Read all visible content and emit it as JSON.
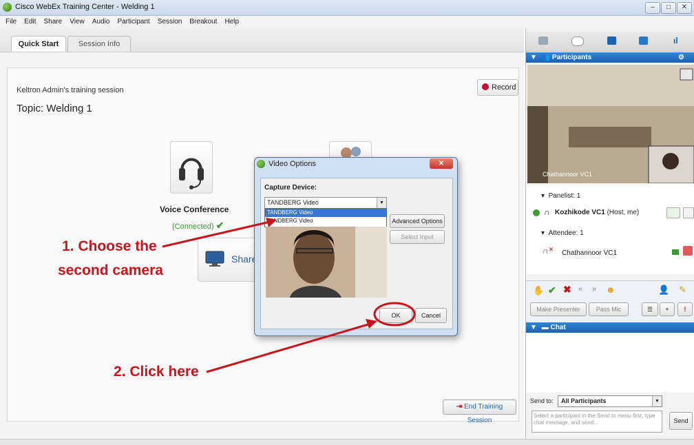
{
  "window": {
    "title": "Cisco WebEx Training Center - Welding 1"
  },
  "menu": [
    "File",
    "Edit",
    "Share",
    "View",
    "Audio",
    "Participant",
    "Session",
    "Breakout",
    "Help"
  ],
  "tabs": {
    "quick_start": "Quick Start",
    "session_info": "Session Info"
  },
  "session": {
    "host_line": "Keltron Admin's training session",
    "topic_label": "Topic:",
    "topic_value": "Welding 1",
    "record_label": "Record",
    "voice_label": "Voice Conference",
    "voice_status": "(Connected)",
    "share_label": "Share",
    "end_session_label": "End Training Session"
  },
  "dialog": {
    "title": "Video Options",
    "capture_label": "Capture Device:",
    "selected": "TANDBERG Video",
    "options": [
      "TANDBERG Video",
      "TANDBERG Video"
    ],
    "advanced_label": "Advanced Options",
    "select_input_label": "Select Input",
    "ok_label": "OK",
    "cancel_label": "Cancel"
  },
  "annotations": {
    "step1_line1": "1. Choose the",
    "step1_line2": "second camera",
    "step2": "2. Click here"
  },
  "participants": {
    "header": "Participants",
    "video_name": "Chathannoor VC1",
    "panelist_group": "Panelist: 1",
    "panelist_name": "Kozhikode VC1",
    "panelist_role": "(Host, me)",
    "attendee_group": "Attendee: 1",
    "attendee_name": "Chathannoor VC1",
    "make_presenter": "Make Presenter",
    "pass_mic": "Pass Mic"
  },
  "chat": {
    "header": "Chat",
    "send_to_label": "Send to:",
    "send_to_value": "All Participants",
    "placeholder": "Select a participant in the Send to menu first, type chat message, and send...",
    "send_label": "Send"
  },
  "colors": {
    "accent": "#1b63b4",
    "annotation": "#c8141c",
    "connected": "#3a9b2f"
  }
}
